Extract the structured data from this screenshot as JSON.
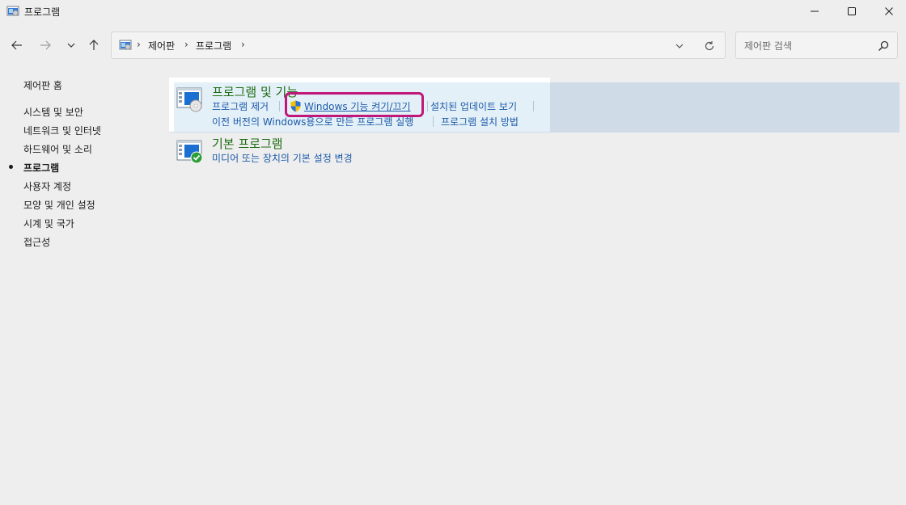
{
  "window": {
    "title": "프로그램",
    "icon": "control-panel-icon"
  },
  "navigation": {
    "breadcrumbs": [
      "제어판",
      "프로그램"
    ],
    "search_placeholder": "제어판 검색"
  },
  "sidebar": {
    "home_label": "제어판 홈",
    "items": [
      {
        "label": "시스템 및 보안",
        "selected": false
      },
      {
        "label": "네트워크 및 인터넷",
        "selected": false
      },
      {
        "label": "하드웨어 및 소리",
        "selected": false
      },
      {
        "label": "프로그램",
        "selected": true
      },
      {
        "label": "사용자 계정",
        "selected": false
      },
      {
        "label": "모양 및 개인 설정",
        "selected": false
      },
      {
        "label": "시계 및 국가",
        "selected": false
      },
      {
        "label": "접근성",
        "selected": false
      }
    ]
  },
  "categories": [
    {
      "title": "프로그램 및 기능",
      "icon": "programs-and-features-icon",
      "links_row1": [
        "프로그램 제거",
        "Windows 기능 켜기/끄기",
        "설치된 업데이트 보기"
      ],
      "links_row2": [
        "이전 버전의 Windows용으로 만든 프로그램 실행",
        "프로그램 설치 방법"
      ]
    },
    {
      "title": "기본 프로그램",
      "icon": "default-programs-icon",
      "links_row1": [
        "미디어 또는 장치의 기본 설정 변경"
      ]
    }
  ],
  "colors": {
    "category_title": "#1e6b13",
    "link": "#1c5aa8",
    "highlight_border": "#c0187a",
    "hover_band": "#cfdce7"
  }
}
